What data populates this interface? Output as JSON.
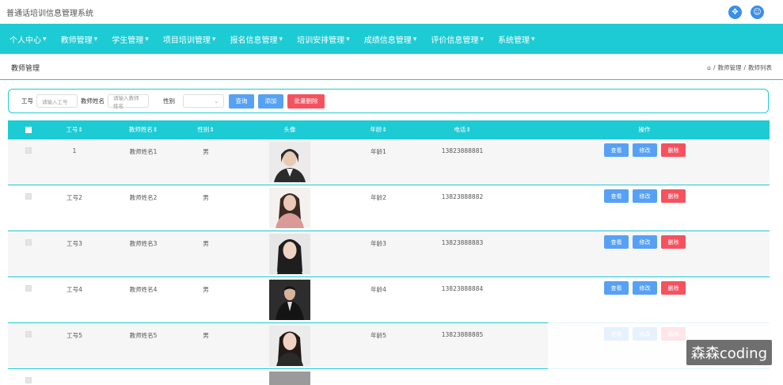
{
  "app": {
    "title": "普通话培训信息管理系统"
  },
  "topbar_icons": [
    "fullscreen-icon",
    "user-icon"
  ],
  "nav": [
    "个人中心",
    "教师管理",
    "学生管理",
    "项目培训管理",
    "报名信息管理",
    "培训安排管理",
    "成绩信息管理",
    "评价信息管理",
    "系统管理"
  ],
  "page": {
    "title": "教师管理"
  },
  "breadcrumb": {
    "home": "⌂",
    "sep": "/",
    "level1": "教师管理",
    "level2": "教师列表"
  },
  "filter": {
    "gonghao_label": "工号",
    "gonghao_placeholder": "请输入工号",
    "name_label": "教师姓名",
    "name_placeholder": "请输入教师姓名",
    "gender_label": "性别",
    "gender_value": "",
    "search_button": "查询",
    "add_button": "添加",
    "batch_delete_button": "批量删除"
  },
  "table": {
    "columns": [
      "工号⇕",
      "教师姓名⇕",
      "性别⇕",
      "头像",
      "年龄⇕",
      "电话⇕",
      "操作"
    ],
    "rows": [
      {
        "gonghao": "1",
        "name": "教师姓名1",
        "gender": "男",
        "age": "年龄1",
        "phone": "13823888881"
      },
      {
        "gonghao": "工号2",
        "name": "教师姓名2",
        "gender": "男",
        "age": "年龄2",
        "phone": "13823888882"
      },
      {
        "gonghao": "工号3",
        "name": "教师姓名3",
        "gender": "男",
        "age": "年龄3",
        "phone": "13823888883"
      },
      {
        "gonghao": "工号4",
        "name": "教师姓名4",
        "gender": "男",
        "age": "年龄4",
        "phone": "13823888884"
      },
      {
        "gonghao": "工号5",
        "name": "教师姓名5",
        "gender": "男",
        "age": "年龄5",
        "phone": "13823888885"
      }
    ],
    "actions": {
      "view": "查看",
      "edit": "修改",
      "delete": "删除"
    }
  },
  "watermark": "森森coding",
  "colors": {
    "nav": "#1dcbd4",
    "primary": "#57a1f5",
    "danger": "#f5525f"
  }
}
